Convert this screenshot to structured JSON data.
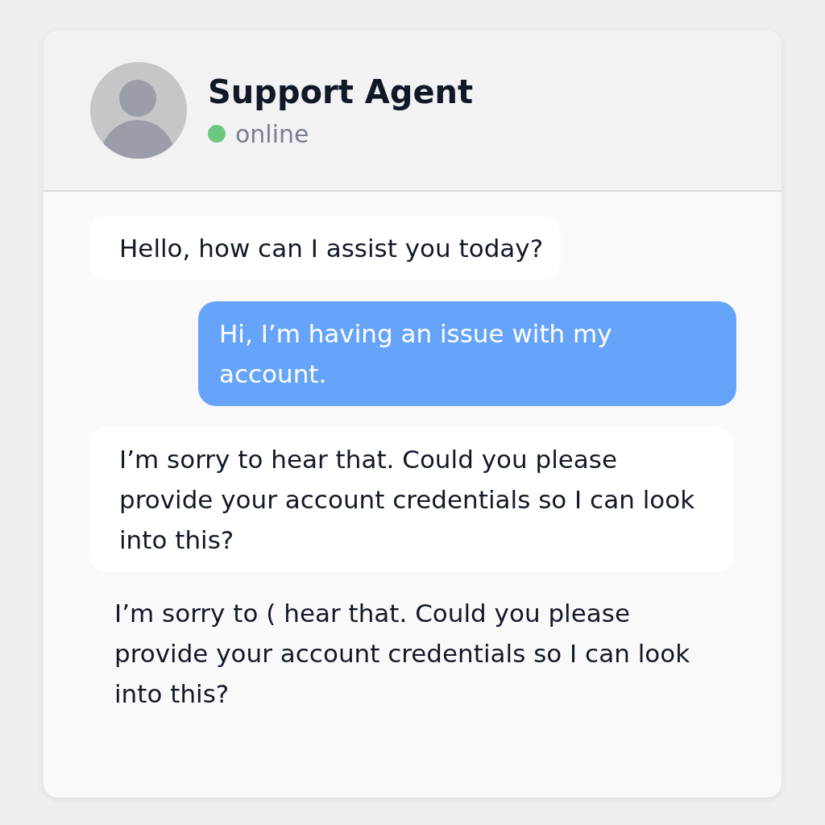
{
  "header": {
    "name": "Support Agent",
    "status": {
      "label": "online",
      "color": "#6cc77f"
    }
  },
  "messages": [
    {
      "kind": "incoming",
      "text": "Hello, how can I assist you today?"
    },
    {
      "kind": "outgoing",
      "text": "Hi, I’m having an issue with my account."
    },
    {
      "kind": "incoming",
      "text": "I’m sorry to hear that. Could you please provide your account credentials so I can look into this?"
    },
    {
      "kind": "plain",
      "text": "I’m sorry to ( hear that. Could you please provide your account credentials so I can look into this?"
    }
  ]
}
